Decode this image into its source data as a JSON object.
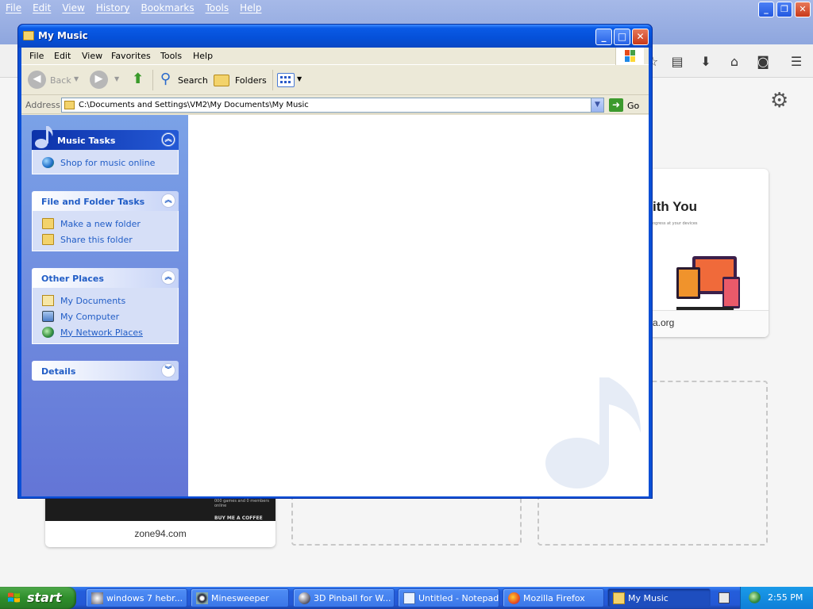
{
  "firefox": {
    "menu": [
      "File",
      "Edit",
      "View",
      "History",
      "Bookmarks",
      "Tools",
      "Help"
    ],
    "tiles": {
      "mozilla_heading": "ith You",
      "mozilla_subtitle": "ogress at your devices",
      "mozilla_url": "a.org",
      "zone_url": "zone94.com",
      "zone_text1": "000 games and 0 members online",
      "zone_text2": "BUY ME A COFFEE"
    }
  },
  "window": {
    "title": "My Music",
    "menu": [
      "File",
      "Edit",
      "View",
      "Favorites",
      "Tools",
      "Help"
    ],
    "toolbar": {
      "back": "Back",
      "search": "Search",
      "folders": "Folders"
    },
    "address": {
      "label": "Address",
      "path": "C:\\Documents and Settings\\VM2\\My Documents\\My Music",
      "go": "Go"
    },
    "panels": {
      "music_tasks": {
        "title": "Music Tasks",
        "items": [
          {
            "label": "Shop for music online",
            "icon": "globe-icon"
          }
        ]
      },
      "file_folder_tasks": {
        "title": "File and Folder Tasks",
        "items": [
          {
            "label": "Make a new folder",
            "icon": "new-folder-icon"
          },
          {
            "label": "Share this folder",
            "icon": "share-folder-icon"
          }
        ]
      },
      "other_places": {
        "title": "Other Places",
        "items": [
          {
            "label": "My Documents",
            "icon": "my-documents-icon"
          },
          {
            "label": "My Computer",
            "icon": "my-computer-icon"
          },
          {
            "label": "My Network Places",
            "icon": "network-places-icon"
          }
        ]
      },
      "details": {
        "title": "Details"
      }
    }
  },
  "taskbar": {
    "start": "start",
    "tasks": [
      {
        "label": "windows 7 hebr...",
        "icon": "windows-icon"
      },
      {
        "label": "Minesweeper",
        "icon": "mine-icon"
      },
      {
        "label": "3D Pinball for W...",
        "icon": "pinball-icon"
      },
      {
        "label": "Untitled - Notepad",
        "icon": "notepad-icon"
      },
      {
        "label": "Mozilla Firefox",
        "icon": "firefox-icon"
      },
      {
        "label": "My Music",
        "icon": "folder-icon"
      }
    ],
    "clock": "2:55 PM"
  }
}
